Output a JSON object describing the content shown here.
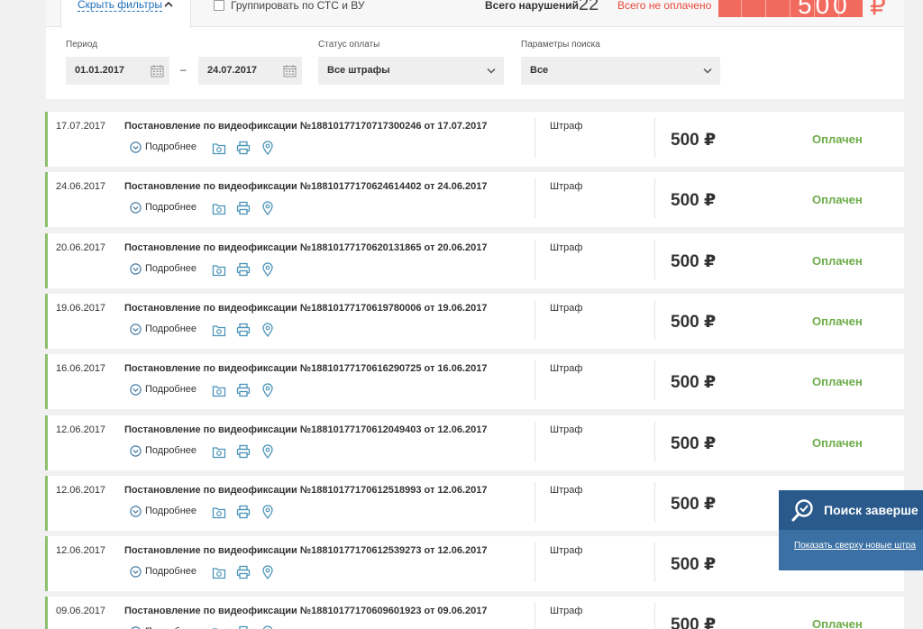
{
  "header": {
    "hide_filters": "Скрыть фильтры",
    "group_label": "Группировать по СТС и ВУ",
    "total_label": "Всего нарушений",
    "total_count": "22",
    "unpaid_label": "Всего не оплачено",
    "unpaid_amount": "500",
    "currency": "₽",
    "colors": {
      "unpaid": "#f26a5e",
      "link": "#1e6fb8"
    }
  },
  "filters": {
    "period_label": "Период",
    "date_from": "01.01.2017",
    "date_to": "24.07.2017",
    "dash": "–",
    "status_label": "Статус оплаты",
    "status_value": "Все штрафы",
    "search_label": "Параметры поиска",
    "search_value": "Все"
  },
  "fines": [
    {
      "date": "17.07.2017",
      "title": "Постановление по видеофиксации №18810177170717300246 от 17.07.2017",
      "more": "Подробнее",
      "type": "Штраф",
      "amount": "500 ₽",
      "status": "Оплачен"
    },
    {
      "date": "24.06.2017",
      "title": "Постановление по видеофиксации №18810177170624614402 от 24.06.2017",
      "more": "Подробнее",
      "type": "Штраф",
      "amount": "500 ₽",
      "status": "Оплачен"
    },
    {
      "date": "20.06.2017",
      "title": "Постановление по видеофиксации №18810177170620131865 от 20.06.2017",
      "more": "Подробнее",
      "type": "Штраф",
      "amount": "500 ₽",
      "status": "Оплачен"
    },
    {
      "date": "19.06.2017",
      "title": "Постановление по видеофиксации №18810177170619780006 от 19.06.2017",
      "more": "Подробнее",
      "type": "Штраф",
      "amount": "500 ₽",
      "status": "Оплачен"
    },
    {
      "date": "16.06.2017",
      "title": "Постановление по видеофиксации №18810177170616290725 от 16.06.2017",
      "more": "Подробнее",
      "type": "Штраф",
      "amount": "500 ₽",
      "status": "Оплачен"
    },
    {
      "date": "12.06.2017",
      "title": "Постановление по видеофиксации №18810177170612049403 от 12.06.2017",
      "more": "Подробнее",
      "type": "Штраф",
      "amount": "500 ₽",
      "status": "Оплачен"
    },
    {
      "date": "12.06.2017",
      "title": "Постановление по видеофиксации №18810177170612518993 от 12.06.2017",
      "more": "Подробнее",
      "type": "Штраф",
      "amount": "500 ₽",
      "status": ""
    },
    {
      "date": "12.06.2017",
      "title": "Постановление по видеофиксации №18810177170612539273 от 12.06.2017",
      "more": "Подробнее",
      "type": "Штраф",
      "amount": "500 ₽",
      "status": ""
    },
    {
      "date": "09.06.2017",
      "title": "Постановление по видеофиксации №18810177170609601923 от 09.06.2017",
      "more": "Подробнее",
      "type": "Штраф",
      "amount": "500 ₽",
      "status": "Оплачен"
    }
  ],
  "row_icons": [
    "chevron-down-circle-icon",
    "camera-folder-icon",
    "printer-icon",
    "map-pin-icon"
  ],
  "status_color": "#6cac48",
  "toast": {
    "title": "Поиск заверше",
    "link": "Показать сверху новые штра",
    "icon": "search-done-icon"
  }
}
